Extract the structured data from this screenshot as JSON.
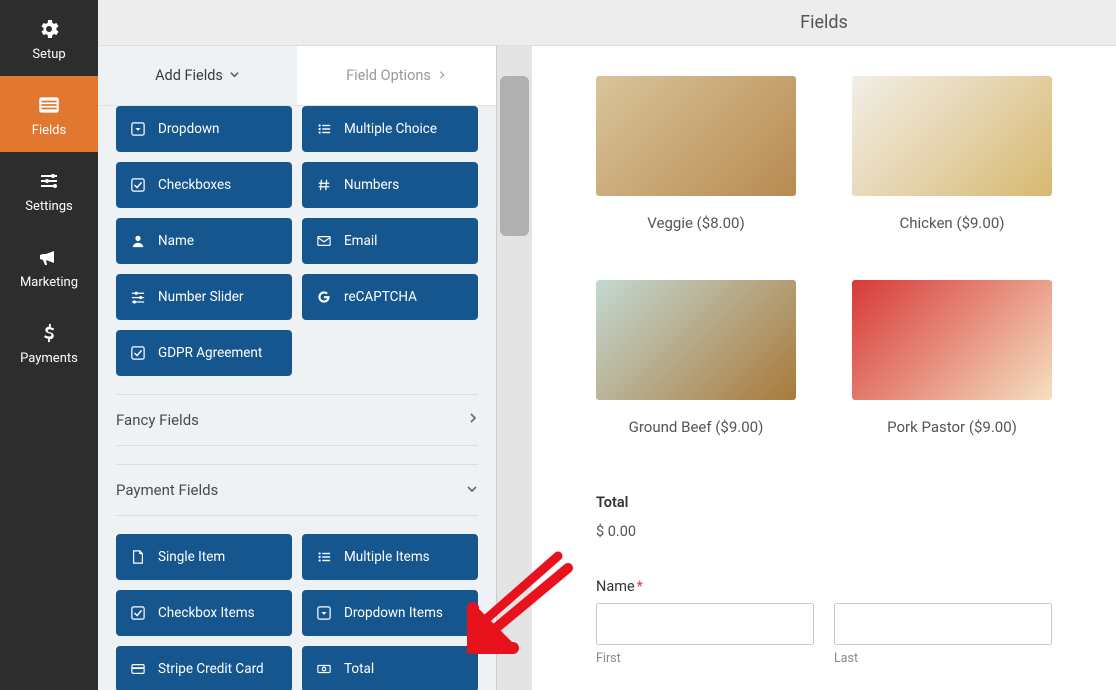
{
  "header": {
    "title": "Fields"
  },
  "leftnav": {
    "items": [
      {
        "id": "setup",
        "label": "Setup",
        "icon": "gear"
      },
      {
        "id": "fields",
        "label": "Fields",
        "icon": "list"
      },
      {
        "id": "settings",
        "label": "Settings",
        "icon": "sliders"
      },
      {
        "id": "marketing",
        "label": "Marketing",
        "icon": "bullhorn"
      },
      {
        "id": "payments",
        "label": "Payments",
        "icon": "dollar"
      }
    ],
    "active": "fields"
  },
  "tabs": {
    "add_fields": "Add Fields",
    "field_options": "Field Options",
    "active": "add_fields"
  },
  "field_buttons": {
    "group_top": [
      {
        "id": "dropdown",
        "label": "Dropdown",
        "icon": "caret-square"
      },
      {
        "id": "multiple_choice",
        "label": "Multiple Choice",
        "icon": "list-ul"
      },
      {
        "id": "checkboxes",
        "label": "Checkboxes",
        "icon": "check-square"
      },
      {
        "id": "numbers",
        "label": "Numbers",
        "icon": "hash"
      },
      {
        "id": "name",
        "label": "Name",
        "icon": "user"
      },
      {
        "id": "email",
        "label": "Email",
        "icon": "envelope"
      },
      {
        "id": "number_slider",
        "label": "Number Slider",
        "icon": "sliders-h"
      },
      {
        "id": "recaptcha",
        "label": "reCAPTCHA",
        "icon": "google"
      },
      {
        "id": "gdpr",
        "label": "GDPR Agreement",
        "icon": "check-square"
      }
    ]
  },
  "sections": {
    "fancy": {
      "label": "Fancy Fields",
      "open": false
    },
    "payment": {
      "label": "Payment Fields",
      "open": true
    }
  },
  "payment_buttons": [
    {
      "id": "single_item",
      "label": "Single Item",
      "icon": "file"
    },
    {
      "id": "multiple_items",
      "label": "Multiple Items",
      "icon": "list-ul"
    },
    {
      "id": "checkbox_items",
      "label": "Checkbox Items",
      "icon": "check-square"
    },
    {
      "id": "dropdown_items",
      "label": "Dropdown Items",
      "icon": "caret-square"
    },
    {
      "id": "stripe_cc",
      "label": "Stripe Credit Card",
      "icon": "credit-card"
    },
    {
      "id": "total",
      "label": "Total",
      "icon": "money"
    }
  ],
  "preview": {
    "products": [
      {
        "id": "veggie",
        "label": "Veggie ($8.00)"
      },
      {
        "id": "chicken",
        "label": "Chicken ($9.00)"
      },
      {
        "id": "ground_beef",
        "label": "Ground Beef ($9.00)"
      },
      {
        "id": "pork_pastor",
        "label": "Pork Pastor ($9.00)"
      }
    ],
    "total": {
      "label": "Total",
      "value": "$ 0.00"
    },
    "name_field": {
      "label": "Name",
      "required": "*",
      "first": {
        "value": "",
        "sublabel": "First"
      },
      "last": {
        "value": "",
        "sublabel": "Last"
      }
    }
  }
}
